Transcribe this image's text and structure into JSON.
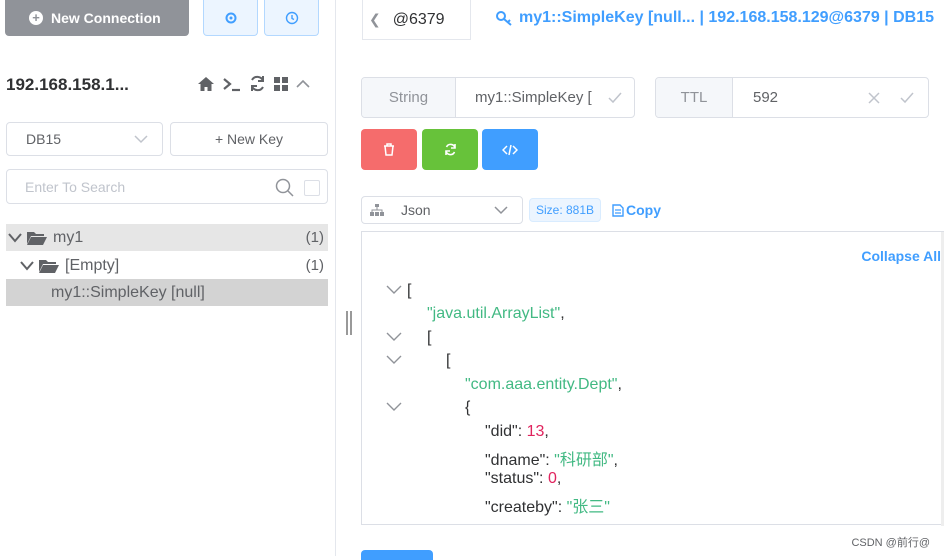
{
  "toolbar": {
    "new_connection_label": "New Connection",
    "settings_icon": "gear-icon",
    "history_icon": "clock-icon"
  },
  "connection": {
    "title": "192.168.158.1...",
    "icons": [
      "home-icon",
      "terminal-icon",
      "refresh-icon",
      "grid-icon",
      "chevron-up-icon"
    ]
  },
  "db_select": {
    "value": "DB15"
  },
  "new_key_label": "+ New Key",
  "search": {
    "placeholder": "Enter To Search"
  },
  "tree": [
    {
      "label": "my1",
      "count": "(1)",
      "level": 0
    },
    {
      "label": "[Empty]",
      "count": "(1)",
      "level": 1
    },
    {
      "label": "my1::SimpleKey [null]",
      "count": "",
      "level": 2
    }
  ],
  "tab": {
    "label": "@6379",
    "title": "my1::SimpleKey [null... | 192.168.158.129@6379 | DB15"
  },
  "key_info": {
    "type_label": "String",
    "key_name": "my1::SimpleKey [",
    "ttl_label": "TTL",
    "ttl_value": "592"
  },
  "actions": {
    "delete_color": "#f56c6c",
    "refresh_color": "#67c23a",
    "code_color": "#409eff"
  },
  "viewer": {
    "format": "Json",
    "size": "Size: 881B",
    "copy_label": "Copy",
    "collapse_label": "Collapse All"
  },
  "json_lines": [
    {
      "text": "[",
      "kind": "punct"
    },
    {
      "text": "\"java.util.ArrayList\"",
      "kind": "string",
      "suffix": ","
    },
    {
      "text": "[",
      "kind": "punct"
    },
    {
      "text": "[",
      "kind": "punct"
    },
    {
      "text": "\"com.aaa.entity.Dept\"",
      "kind": "string",
      "suffix": ","
    },
    {
      "text": "{",
      "kind": "punct"
    },
    {
      "key": "\"did\"",
      "value": "13",
      "vkind": "number"
    },
    {
      "key": "\"dname\"",
      "value": "\"科研部\"",
      "vkind": "string"
    },
    {
      "key": "\"status\"",
      "value": "0",
      "vkind": "number"
    },
    {
      "key": "\"createby\"",
      "value": "\"张三\"",
      "vkind": "string",
      "nocomma": true
    }
  ],
  "watermark": "CSDN @前行@"
}
